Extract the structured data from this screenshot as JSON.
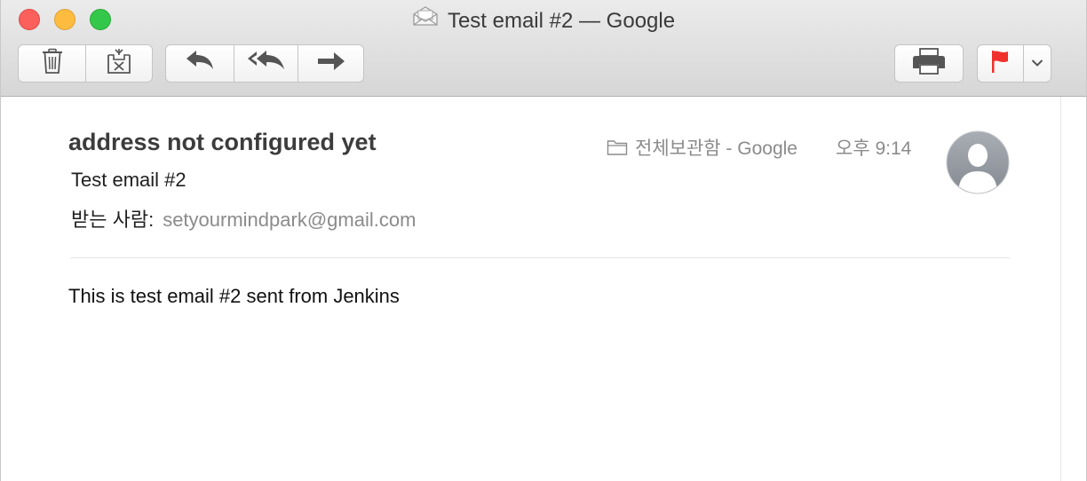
{
  "window": {
    "title": "Test email #2 — Google"
  },
  "toolbar": {
    "delete_icon": "trash-icon",
    "junk_icon": "junk-icon",
    "reply_icon": "reply-icon",
    "reply_all_icon": "reply-all-icon",
    "forward_icon": "forward-icon",
    "print_icon": "printer-icon",
    "flag_icon": "flag-icon",
    "flag_color": "#f0302c",
    "flag_menu_icon": "chevron-down-icon"
  },
  "message": {
    "sender": "address not configured yet",
    "subject": "Test email #2",
    "recipient_label": "받는 사람:",
    "recipient_address": "setyourmindpark@gmail.com",
    "mailbox": "전체보관함 - Google",
    "time": "오후 9:14",
    "body": "This is test email #2 sent from Jenkins"
  }
}
